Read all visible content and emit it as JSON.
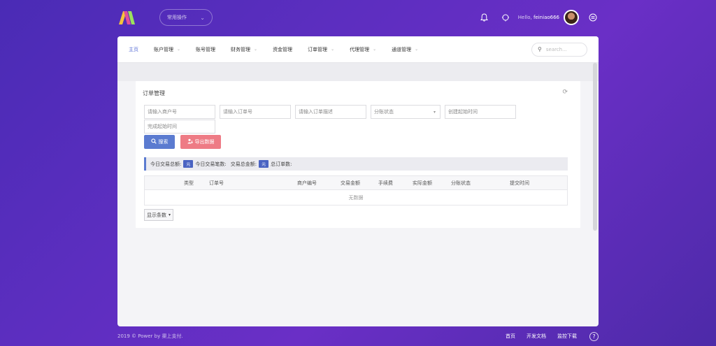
{
  "topbar": {
    "quick_label": "常用操作",
    "hello_prefix": "Hello,",
    "username": "feiniao666"
  },
  "nav": {
    "items": [
      {
        "label": "主页",
        "dropdown": false,
        "active": true
      },
      {
        "label": "账户管理",
        "dropdown": true,
        "active": false
      },
      {
        "label": "账号管理",
        "dropdown": false,
        "active": false
      },
      {
        "label": "财务管理",
        "dropdown": true,
        "active": false
      },
      {
        "label": "资金管理",
        "dropdown": false,
        "active": false
      },
      {
        "label": "订单管理",
        "dropdown": true,
        "active": false
      },
      {
        "label": "代理管理",
        "dropdown": true,
        "active": false
      },
      {
        "label": "通道管理",
        "dropdown": true,
        "active": false
      }
    ],
    "search_placeholder": "search..."
  },
  "panel": {
    "title": "订单管理",
    "filters": {
      "merchant_no": "请输入商户号",
      "order_no": "请输入订单号",
      "order_desc": "请输入订单描述",
      "split_status": "分账状态",
      "create_start": "创建起始时间",
      "complete_start": "完成起始时间"
    },
    "search_button": "搜索",
    "export_button": "导出数据",
    "stats": {
      "today_total": "今日交易总额:",
      "today_count": "今日交易笔数:",
      "trade_total": "交易总金额:",
      "total_orders": "总订单数:",
      "unit": "元"
    },
    "table": {
      "columns": [
        "类型",
        "订单号",
        "商户编号",
        "交易金额",
        "手续费",
        "实际金额",
        "分账状态",
        "提交时间"
      ],
      "empty_text": "无数据"
    },
    "page_size_label": "显示条数"
  },
  "footer": {
    "copyright": "2019 © Power by 渠上支付.",
    "links": [
      "首页",
      "开发文档",
      "监控下载"
    ]
  },
  "colors": {
    "accent": "#5b7bd0",
    "export": "#ee7b85",
    "badge": "#4a63c2"
  }
}
